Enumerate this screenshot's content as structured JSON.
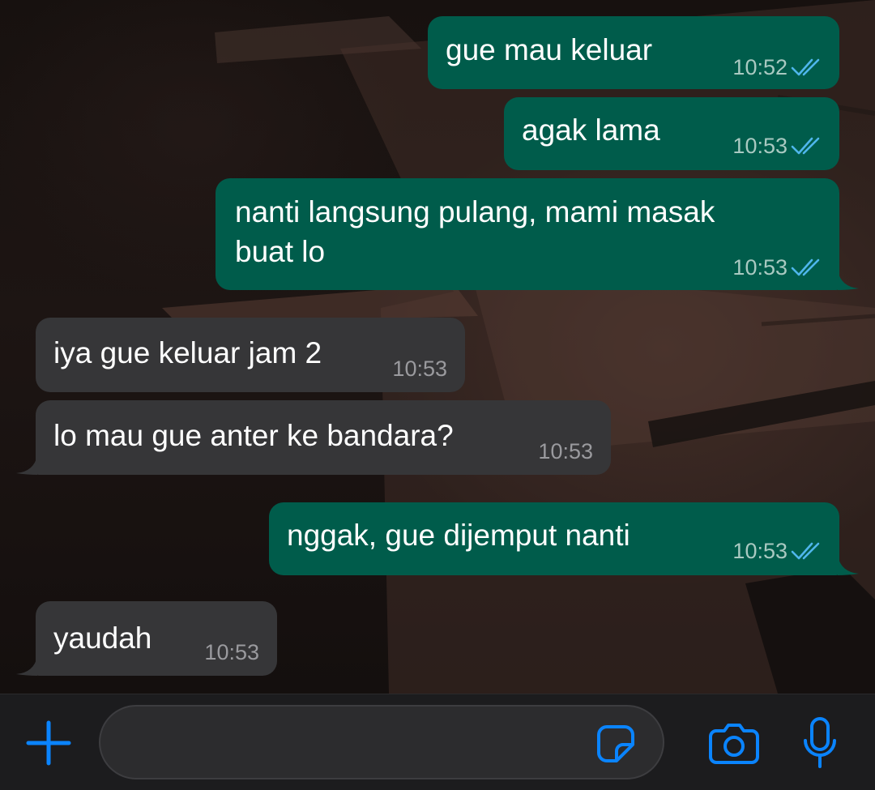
{
  "theme": {
    "outgoing_bubble": "#005c4b",
    "incoming_bubble": "#363638",
    "accent": "#0a84ff",
    "read_tick": "#4fb6ec"
  },
  "messages": [
    {
      "direction": "outgoing",
      "text": "gue mau keluar",
      "time": "10:52",
      "status": "read"
    },
    {
      "direction": "outgoing",
      "text": "agak lama",
      "time": "10:53",
      "status": "read"
    },
    {
      "direction": "outgoing",
      "text_lines": [
        "nanti langsung pulang, mami masak",
        "buat lo"
      ],
      "time": "10:53",
      "status": "read"
    },
    {
      "direction": "incoming",
      "text": "iya gue keluar jam 2",
      "time": "10:53"
    },
    {
      "direction": "incoming",
      "text": "lo mau gue anter ke bandara?",
      "time": "10:53"
    },
    {
      "direction": "outgoing",
      "text": "nggak, gue dijemput nanti",
      "time": "10:53",
      "status": "read"
    },
    {
      "direction": "incoming",
      "text": "yaudah",
      "time": "10:53"
    }
  ],
  "input_bar": {
    "message_value": "",
    "icons": [
      "plus-icon",
      "sticker-icon",
      "camera-icon",
      "microphone-icon"
    ]
  }
}
